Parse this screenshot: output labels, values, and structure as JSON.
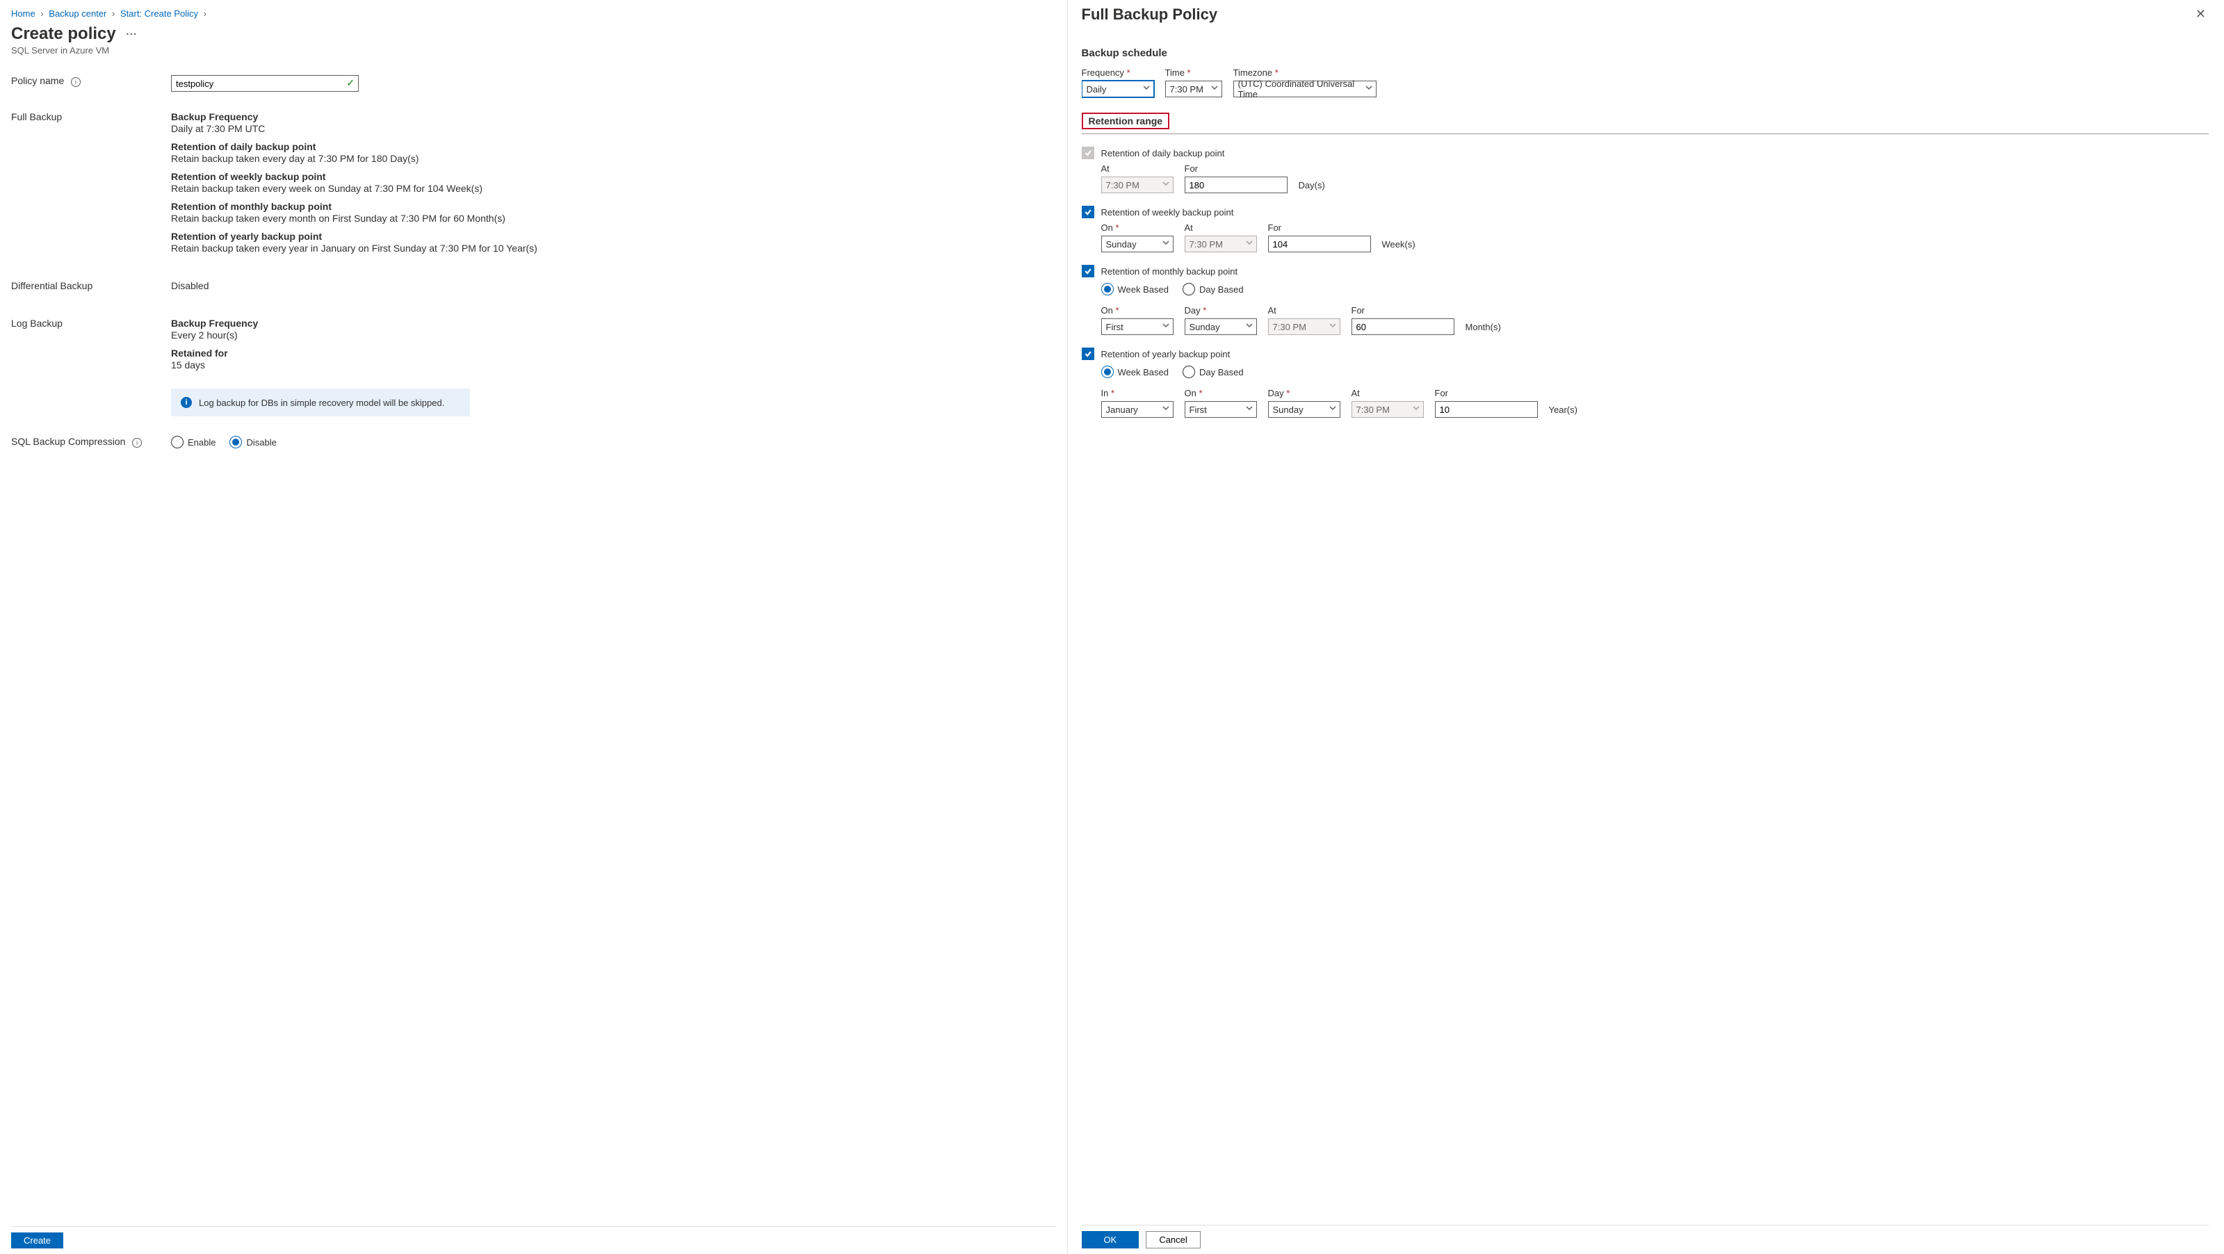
{
  "breadcrumbs": [
    "Home",
    "Backup center",
    "Start: Create Policy"
  ],
  "page": {
    "title": "Create policy",
    "subtitle": "SQL Server in Azure VM"
  },
  "policyName": {
    "label": "Policy name",
    "value": "testpolicy"
  },
  "fullBackup": {
    "label": "Full Backup",
    "freqTitle": "Backup Frequency",
    "freqText": "Daily at 7:30 PM UTC",
    "dailyTitle": "Retention of daily backup point",
    "dailyText": "Retain backup taken every day at 7:30 PM for 180 Day(s)",
    "weeklyTitle": "Retention of weekly backup point",
    "weeklyText": "Retain backup taken every week on Sunday at 7:30 PM for 104 Week(s)",
    "monthlyTitle": "Retention of monthly backup point",
    "monthlyText": "Retain backup taken every month on First Sunday at 7:30 PM for 60 Month(s)",
    "yearlyTitle": "Retention of yearly backup point",
    "yearlyText": "Retain backup taken every year in January on First Sunday at 7:30 PM for 10 Year(s)"
  },
  "diffBackup": {
    "label": "Differential Backup",
    "value": "Disabled"
  },
  "logBackup": {
    "label": "Log Backup",
    "freqTitle": "Backup Frequency",
    "freqText": "Every 2 hour(s)",
    "retTitle": "Retained for",
    "retText": "15 days",
    "callout": "Log backup for DBs in simple recovery model will be skipped."
  },
  "compression": {
    "label": "SQL Backup Compression",
    "enable": "Enable",
    "disable": "Disable"
  },
  "footer": {
    "create": "Create"
  },
  "rightPane": {
    "title": "Full Backup Policy",
    "schedule": {
      "heading": "Backup schedule",
      "freqLabel": "Frequency",
      "freqValue": "Daily",
      "timeLabel": "Time",
      "timeValue": "7:30 PM",
      "tzLabel": "Timezone",
      "tzValue": "(UTC) Coordinated Universal Time"
    },
    "retentionHeading": "Retention range",
    "daily": {
      "label": "Retention of daily backup point",
      "atLabel": "At",
      "atValue": "7:30 PM",
      "forLabel": "For",
      "forValue": "180",
      "unit": "Day(s)"
    },
    "weekly": {
      "label": "Retention of weekly backup point",
      "onLabel": "On",
      "onValue": "Sunday",
      "atLabel": "At",
      "atValue": "7:30 PM",
      "forLabel": "For",
      "forValue": "104",
      "unit": "Week(s)"
    },
    "monthly": {
      "label": "Retention of monthly backup point",
      "weekBased": "Week Based",
      "dayBased": "Day Based",
      "onLabel": "On",
      "onValue": "First",
      "dayLabel": "Day",
      "dayValue": "Sunday",
      "atLabel": "At",
      "atValue": "7:30 PM",
      "forLabel": "For",
      "forValue": "60",
      "unit": "Month(s)"
    },
    "yearly": {
      "label": "Retention of yearly backup point",
      "weekBased": "Week Based",
      "dayBased": "Day Based",
      "inLabel": "In",
      "inValue": "January",
      "onLabel": "On",
      "onValue": "First",
      "dayLabel": "Day",
      "dayValue": "Sunday",
      "atLabel": "At",
      "atValue": "7:30 PM",
      "forLabel": "For",
      "forValue": "10",
      "unit": "Year(s)"
    },
    "footer": {
      "ok": "OK",
      "cancel": "Cancel"
    }
  }
}
